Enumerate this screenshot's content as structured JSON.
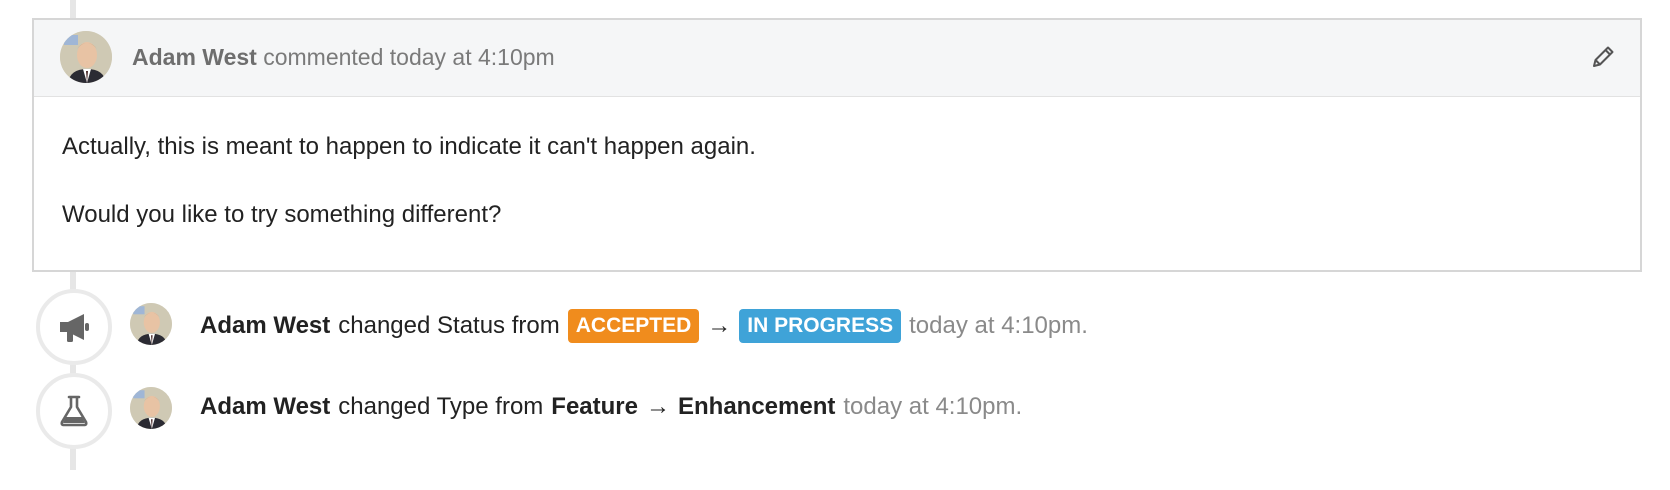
{
  "comment": {
    "author": "Adam West",
    "action": "commented today at 4:10pm",
    "paragraphs": [
      "Actually, this is meant to happen to indicate it can't happen again.",
      "Would you like to try something different?"
    ],
    "edit_icon": "pencil-icon"
  },
  "events": [
    {
      "icon": "megaphone-icon",
      "author": "Adam West",
      "action": "changed Status from",
      "from": "ACCEPTED",
      "from_color": "#f08c1d",
      "arrow": "→",
      "to": "IN PROGRESS",
      "to_color": "#3fa3d8",
      "time": "today at 4:10pm."
    },
    {
      "icon": "flask-icon",
      "author": "Adam West",
      "action": "changed Type from",
      "from": "Feature",
      "arrow": "→",
      "to": "Enhancement",
      "time": "today at 4:10pm."
    }
  ]
}
